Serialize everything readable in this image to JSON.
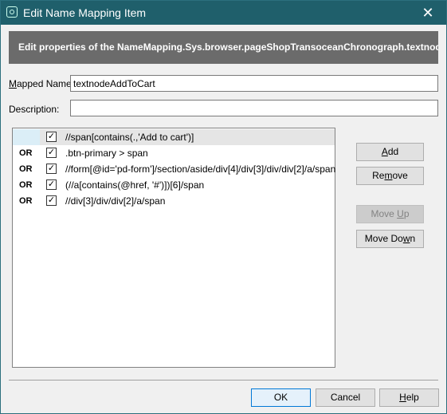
{
  "window": {
    "title": "Edit Name Mapping Item"
  },
  "banner": {
    "text": "Edit properties of the NameMapping.Sys.browser.pageShopTransoceanChronograph.textnode"
  },
  "fields": {
    "mapped_name_label": "Mapped Name:",
    "mapped_name_value": "textnodeAddToCart",
    "description_label": "Description:",
    "description_value": ""
  },
  "list": {
    "rows": [
      {
        "prefix": "",
        "checked": true,
        "path": "//span[contains(.,'Add to cart')]"
      },
      {
        "prefix": "OR",
        "checked": true,
        "path": ".btn-primary > span"
      },
      {
        "prefix": "OR",
        "checked": true,
        "path": "//form[@id='pd-form']/section/aside/div[4]/div[3]/div/div[2]/a/span"
      },
      {
        "prefix": "OR",
        "checked": true,
        "path": "(//a[contains(@href, '#')])[6]/span"
      },
      {
        "prefix": "OR",
        "checked": true,
        "path": "//div[3]/div/div[2]/a/span"
      }
    ]
  },
  "side_buttons": {
    "add": "Add",
    "remove": "Remove",
    "move_up": "Move Up",
    "move_down": "Move Down"
  },
  "footer": {
    "ok": "OK",
    "cancel": "Cancel",
    "help": "Help"
  },
  "colors": {
    "titlebar": "#1f5f6b",
    "banner": "#6b6b6b",
    "selected_row": "#e5e5e5",
    "default_button_border": "#0078d7"
  }
}
